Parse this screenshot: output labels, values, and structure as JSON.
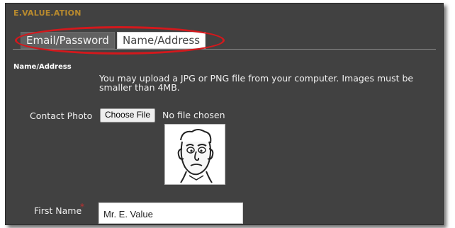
{
  "app": {
    "title": "E.VALUE.ATION"
  },
  "tabs": [
    {
      "label": "Email/Password",
      "active": false
    },
    {
      "label": "Name/Address",
      "active": true
    }
  ],
  "section": {
    "title": "Name/Address"
  },
  "upload": {
    "help_text": "You may upload a JPG or PNG file from your computer. Images must be smaller than 4MB.",
    "label": "Contact Photo",
    "button_label": "Choose File",
    "status": "No file chosen"
  },
  "first_name": {
    "label": "First Name",
    "required_marker": "*",
    "value": "Mr. E. Value"
  },
  "colors": {
    "panel_bg": "#414141",
    "accent": "#b88a2e",
    "highlight": "#d4181c",
    "required": "#c23030"
  }
}
